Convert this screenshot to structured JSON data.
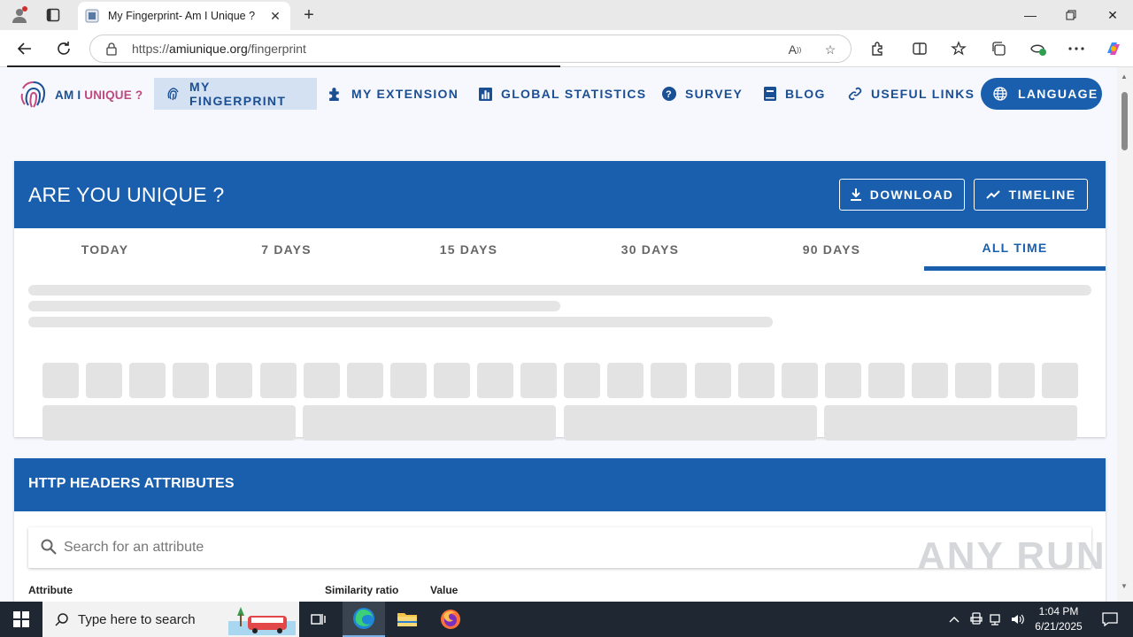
{
  "browser": {
    "tab_title": "My Fingerprint- Am I Unique ?",
    "url_prefix": "https://",
    "url_domain": "amiunique.org",
    "url_path": "/fingerprint"
  },
  "site": {
    "logo_text": "AM I UNIQUE ?",
    "nav": [
      {
        "label": "MY FINGERPRINT"
      },
      {
        "label": "MY EXTENSION"
      },
      {
        "label": "GLOBAL STATISTICS"
      },
      {
        "label": "SURVEY"
      },
      {
        "label": "BLOG"
      },
      {
        "label": "USEFUL LINKS"
      }
    ],
    "language_label": "LANGUAGE"
  },
  "unique_card": {
    "title": "ARE YOU UNIQUE ?",
    "download_label": "DOWNLOAD",
    "timeline_label": "TIMELINE",
    "tabs": [
      "TODAY",
      "7 DAYS",
      "15 DAYS",
      "30 DAYS",
      "90 DAYS",
      "ALL TIME"
    ],
    "active_tab": "ALL TIME"
  },
  "headers_card": {
    "title": "HTTP HEADERS ATTRIBUTES",
    "search_placeholder": "Search for an attribute",
    "columns": [
      "Attribute",
      "Similarity ratio",
      "Value"
    ]
  },
  "watermark": "ANY RUN",
  "taskbar": {
    "search_placeholder": "Type here to search",
    "time": "1:04 PM",
    "date": "6/21/2025"
  },
  "colors": {
    "primary": "#1a5fad",
    "nav_text": "#1b4f93",
    "active_nav_bg": "#d3e1f3",
    "logo_pink": "#c0497f"
  }
}
